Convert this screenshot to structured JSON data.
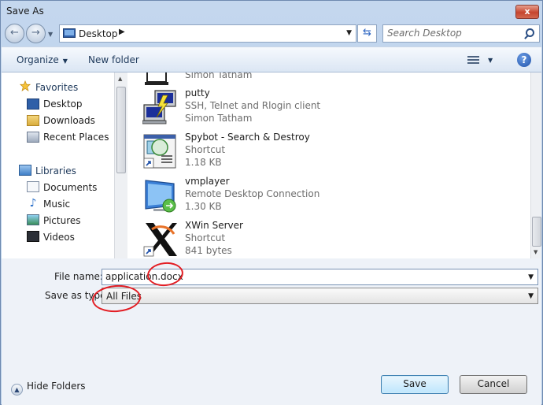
{
  "window": {
    "title": "Save As",
    "close_glyph": "x"
  },
  "navigation": {
    "back_glyph": "←",
    "forward_glyph": "→",
    "address_location": "Desktop",
    "address_chevron": "▶",
    "search_placeholder": "Search Desktop"
  },
  "toolbar": {
    "organize_label": "Organize",
    "new_folder_label": "New folder",
    "help_glyph": "?"
  },
  "sidebar": {
    "favorites_heading": "Favorites",
    "favorites": [
      {
        "label": "Desktop",
        "icon": "desktop-icon"
      },
      {
        "label": "Downloads",
        "icon": "downloads-folder-icon"
      },
      {
        "label": "Recent Places",
        "icon": "recent-places-icon"
      }
    ],
    "libraries_heading": "Libraries",
    "libraries": [
      {
        "label": "Documents",
        "icon": "documents-icon"
      },
      {
        "label": "Music",
        "icon": "music-icon"
      },
      {
        "label": "Pictures",
        "icon": "pictures-icon"
      },
      {
        "label": "Videos",
        "icon": "videos-icon"
      }
    ]
  },
  "files": [
    {
      "name": "",
      "line1": "Simon Tatham",
      "line2": "",
      "icon": "putty-config-icon"
    },
    {
      "name": "putty",
      "line1": "SSH, Telnet and Rlogin client",
      "line2": "Simon Tatham",
      "icon": "putty-icon"
    },
    {
      "name": "Spybot - Search & Destroy",
      "line1": "Shortcut",
      "line2": "1.18 KB",
      "icon": "spybot-icon"
    },
    {
      "name": "vmplayer",
      "line1": "Remote Desktop Connection",
      "line2": "1.30 KB",
      "icon": "remote-desktop-icon"
    },
    {
      "name": "XWin Server",
      "line1": "Shortcut",
      "line2": "841 bytes",
      "icon": "xwin-icon"
    }
  ],
  "form": {
    "file_name_label": "File name:",
    "file_name_value": "application.docx",
    "save_type_label": "Save as type:",
    "save_type_value": "All Files"
  },
  "footer": {
    "hide_folders_label": "Hide Folders",
    "save_label": "Save",
    "cancel_label": "Cancel"
  },
  "colors": {
    "annotation_red": "#e31e24",
    "window_frame": "#b9d1ea",
    "save_button_border": "#3c7fb1"
  }
}
